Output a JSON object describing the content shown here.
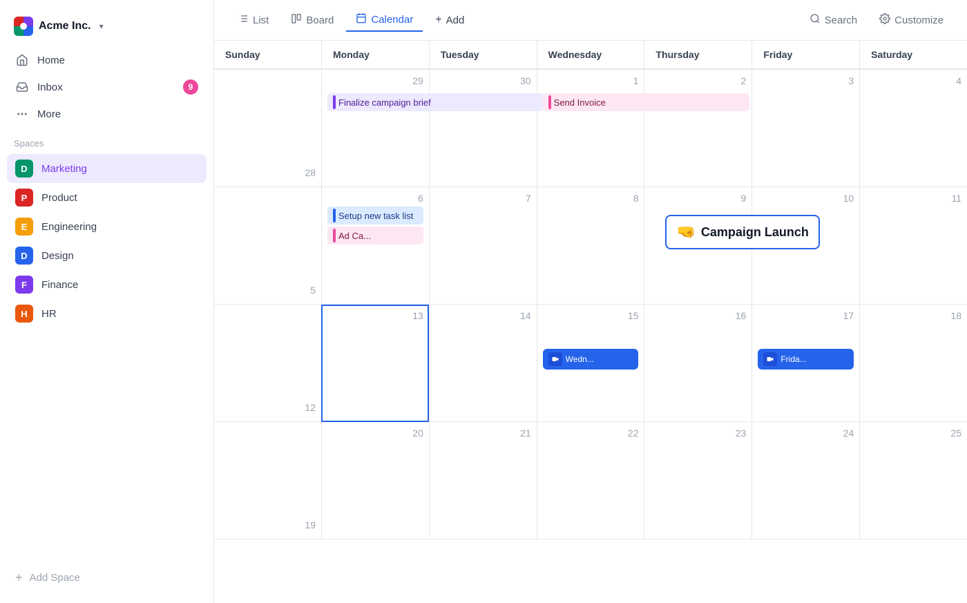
{
  "app": {
    "name": "Acme Inc.",
    "logo_chevron": "▾"
  },
  "nav": {
    "items": [
      {
        "id": "home",
        "label": "Home",
        "icon": "home"
      },
      {
        "id": "inbox",
        "label": "Inbox",
        "icon": "inbox",
        "badge": "9"
      },
      {
        "id": "more",
        "label": "More",
        "icon": "more"
      }
    ]
  },
  "spaces": {
    "label": "Spaces",
    "items": [
      {
        "id": "marketing",
        "label": "Marketing",
        "abbr": "D",
        "color": "#059669",
        "active": true
      },
      {
        "id": "product",
        "label": "Product",
        "abbr": "P",
        "color": "#dc2626"
      },
      {
        "id": "engineering",
        "label": "Engineering",
        "abbr": "E",
        "color": "#f59e0b"
      },
      {
        "id": "design",
        "label": "Design",
        "abbr": "D",
        "color": "#2563eb"
      },
      {
        "id": "finance",
        "label": "Finance",
        "abbr": "F",
        "color": "#7c3aed"
      },
      {
        "id": "hr",
        "label": "HR",
        "abbr": "H",
        "color": "#ea580c"
      }
    ],
    "add_label": "Add Space"
  },
  "toolbar": {
    "tabs": [
      {
        "id": "list",
        "label": "List",
        "icon": "list"
      },
      {
        "id": "board",
        "label": "Board",
        "icon": "board"
      },
      {
        "id": "calendar",
        "label": "Calendar",
        "icon": "calendar",
        "active": true
      }
    ],
    "add_label": "Add",
    "search_label": "Search",
    "customize_label": "Customize"
  },
  "calendar": {
    "days": [
      "Sunday",
      "Monday",
      "Tuesday",
      "Wednesday",
      "Thursday",
      "Friday",
      "Saturday"
    ],
    "weeks": [
      {
        "cells": [
          {
            "date": "28",
            "sunday": true
          },
          {
            "date": "29"
          },
          {
            "date": "30"
          },
          {
            "date": "1"
          },
          {
            "date": "2"
          },
          {
            "date": "3"
          },
          {
            "date": "4"
          }
        ],
        "events": [
          {
            "col": 1,
            "label": "Finalize campaign brief",
            "type": "purple",
            "span": 2
          },
          {
            "col": 3,
            "label": "Send Invoice",
            "type": "pink",
            "span": 2
          }
        ]
      },
      {
        "cells": [
          {
            "date": "5",
            "sunday": true
          },
          {
            "date": "6"
          },
          {
            "date": "7"
          },
          {
            "date": "8"
          },
          {
            "date": "9"
          },
          {
            "date": "10"
          },
          {
            "date": "11"
          }
        ],
        "events": [
          {
            "col": 1,
            "label": "Setup new task list",
            "type": "blue"
          },
          {
            "col": 1,
            "label": "Ad Ca...",
            "type": "pink"
          },
          {
            "col": 4,
            "label": "Campaign Launch",
            "type": "campaign"
          }
        ]
      },
      {
        "cells": [
          {
            "date": "12",
            "sunday": true
          },
          {
            "date": "13",
            "today": true
          },
          {
            "date": "14"
          },
          {
            "date": "15"
          },
          {
            "date": "16"
          },
          {
            "date": "17"
          },
          {
            "date": "18"
          }
        ],
        "events": [
          {
            "col": 3,
            "label": "Wedn...",
            "type": "meeting"
          },
          {
            "col": 5,
            "label": "Frida...",
            "type": "meeting"
          }
        ]
      },
      {
        "cells": [
          {
            "date": "19",
            "sunday": true
          },
          {
            "date": "20"
          },
          {
            "date": "21"
          },
          {
            "date": "22"
          },
          {
            "date": "23"
          },
          {
            "date": "24"
          },
          {
            "date": "25"
          }
        ],
        "events": []
      }
    ]
  }
}
